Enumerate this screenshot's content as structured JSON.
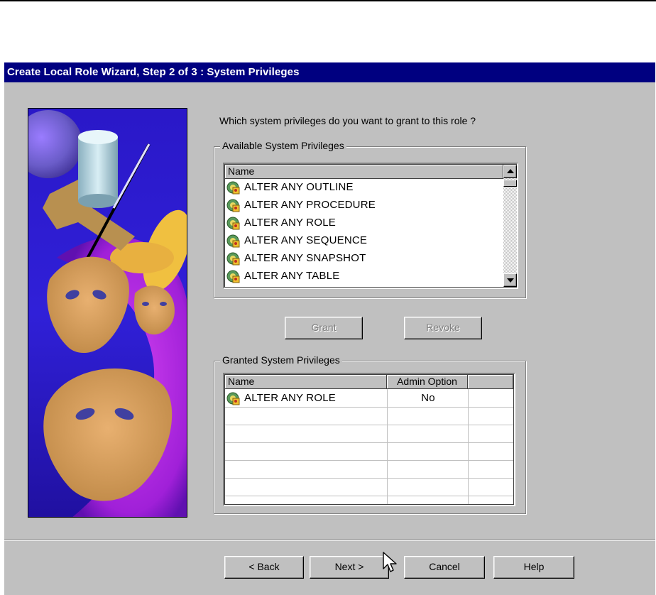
{
  "window": {
    "title": "Create Local Role Wizard, Step 2 of 3 : System Privileges"
  },
  "question": "Which system privileges do you want to grant to this role ?",
  "available": {
    "group_label": "Available System Privileges",
    "column_name": "Name",
    "items": [
      "ALTER ANY OUTLINE",
      "ALTER ANY PROCEDURE",
      "ALTER ANY ROLE",
      "ALTER ANY SEQUENCE",
      "ALTER ANY SNAPSHOT",
      "ALTER ANY TABLE"
    ],
    "row_icon": "privilege-icon"
  },
  "actions": {
    "grant_label": "Grant",
    "revoke_label": "Revoke"
  },
  "granted": {
    "group_label": "Granted System Privileges",
    "column_name": "Name",
    "column_admin": "Admin Option",
    "rows": [
      {
        "name": "ALTER ANY ROLE",
        "admin": "No"
      }
    ]
  },
  "footer": {
    "back_label": "< Back",
    "next_label": "Next >",
    "cancel_label": "Cancel",
    "help_label": "Help"
  },
  "colors": {
    "titlebar": "#000080",
    "dialog": "#c0c0c0",
    "disabled_text": "#808080"
  }
}
